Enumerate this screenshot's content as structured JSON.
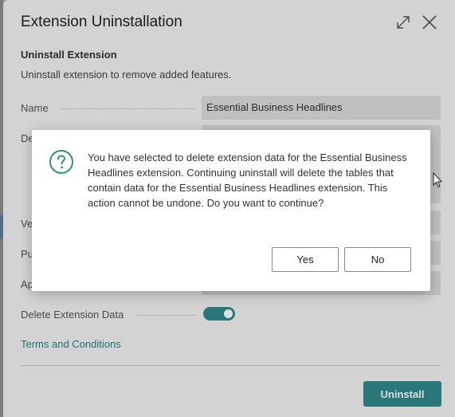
{
  "window": {
    "title": "Extension Uninstallation",
    "expand_icon": "expand-icon",
    "close_icon": "close-icon"
  },
  "section": {
    "title": "Uninstall Extension",
    "description": "Uninstall extension to remove added features."
  },
  "fields": {
    "name": {
      "label": "Name",
      "value": "Essential Business Headlines"
    },
    "description": {
      "label_partial": "De"
    },
    "version": {
      "label_partial": "Ve"
    },
    "publisher": {
      "label_partial": "Pu"
    },
    "app_id": {
      "label_partial": "Ap"
    },
    "delete_data": {
      "label": "Delete Extension Data",
      "enabled": true
    }
  },
  "terms_link": "Terms and Conditions",
  "uninstall_button": "Uninstall",
  "colors": {
    "accent": "#2e8a8c",
    "link": "#2a7f86"
  },
  "dialog": {
    "icon": "question-icon",
    "message": "You have selected to delete extension data for the Essential Business Headlines extension. Continuing uninstall will delete the tables that contain data for the Essential Business Headlines extension. This action cannot be undone. Do you want to continue?",
    "yes": "Yes",
    "no": "No"
  }
}
